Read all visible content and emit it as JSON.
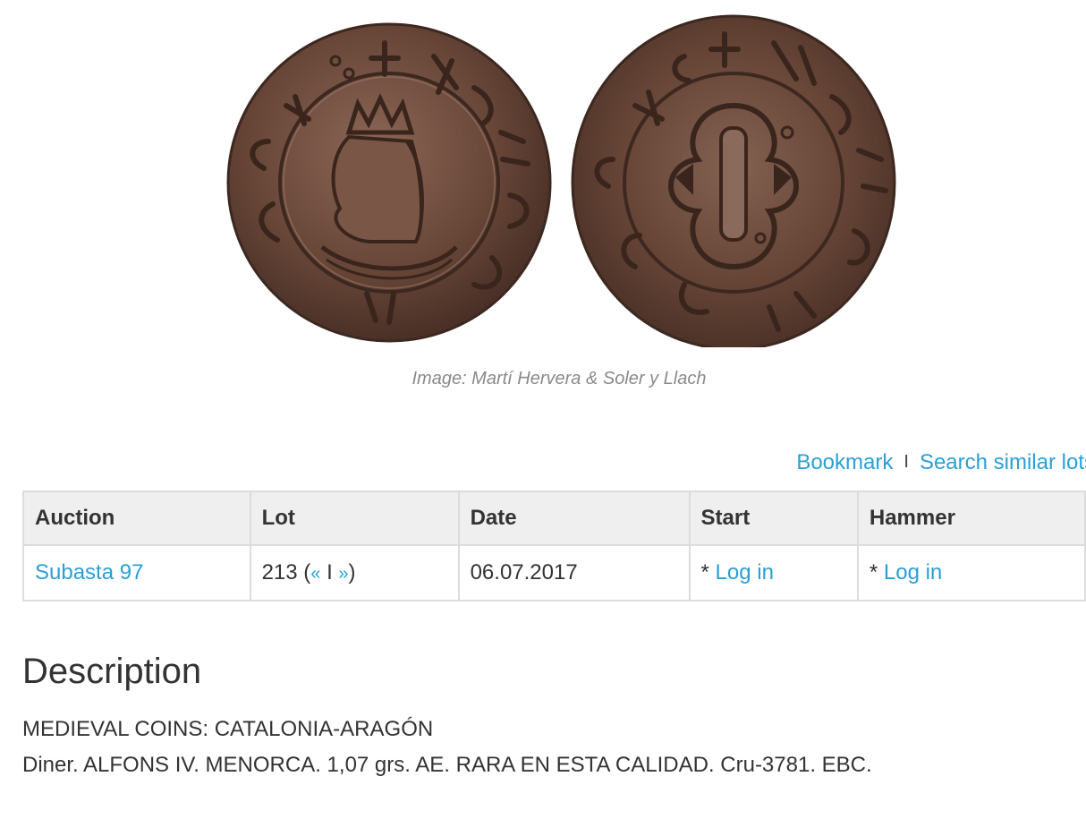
{
  "image": {
    "caption": "Image: Martí Hervera & Soler y Llach"
  },
  "actions": {
    "bookmark_label": "Bookmark",
    "separator": "I",
    "search_similar_label": "Search similar lots"
  },
  "lot_table": {
    "headers": [
      "Auction",
      "Lot",
      "Date",
      "Start",
      "Hammer"
    ],
    "row": {
      "auction": "Subasta 97",
      "lot_number": "213 (",
      "prev": "«",
      "nav_sep": " I ",
      "next": "»",
      "lot_close": ")",
      "date": "06.07.2017",
      "start_prefix": "* ",
      "start_link": "Log in",
      "hammer_prefix": "* ",
      "hammer_link": "Log in"
    }
  },
  "description": {
    "heading": "Description",
    "category": "MEDIEVAL COINS: CATALONIA-ARAGÓN",
    "text": "Diner. ALFONS IV. MENORCA. 1,07 grs. AE. RARA EN ESTA CALIDAD. Cru-3781. EBC."
  },
  "colors": {
    "link": "#2a9fd6",
    "header_bg": "#efefef",
    "coin_bronze": "#6e4a3a"
  }
}
